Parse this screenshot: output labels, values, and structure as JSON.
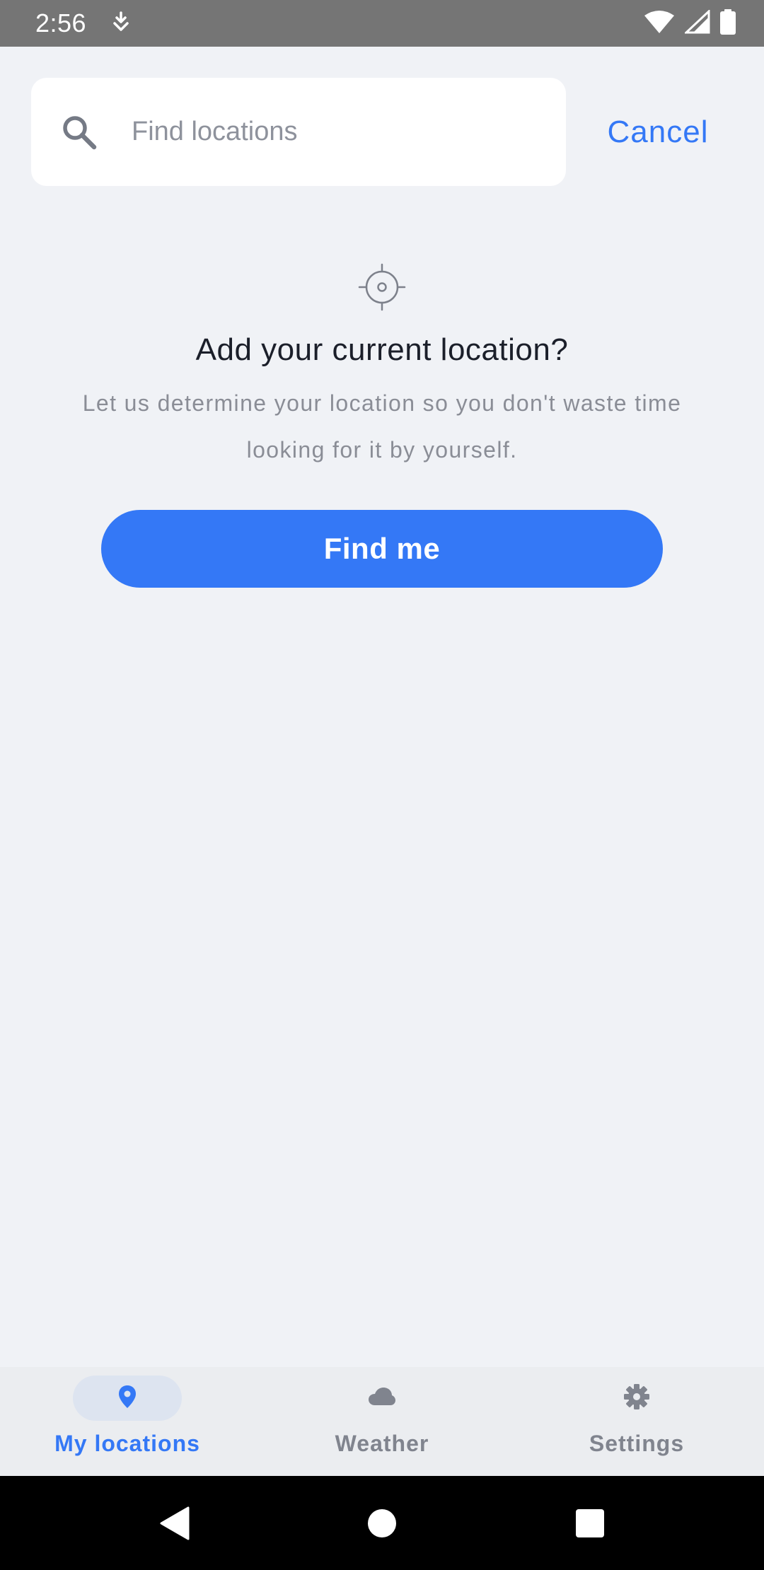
{
  "status_bar": {
    "time": "2:56",
    "icons": [
      "download-status-icon",
      "wifi-icon",
      "signal-icon",
      "battery-icon"
    ]
  },
  "search": {
    "placeholder": "Find locations",
    "value": "",
    "cancel_label": "Cancel"
  },
  "empty_state": {
    "icon": "crosshair-locate-icon",
    "title": "Add your current location?",
    "description": "Let us determine your location so you don't waste time looking for it by yourself.",
    "button_label": "Find me"
  },
  "bottom_nav": {
    "items": [
      {
        "label": "My locations",
        "icon": "map-pin-icon",
        "active": true
      },
      {
        "label": "Weather",
        "icon": "cloud-icon",
        "active": false
      },
      {
        "label": "Settings",
        "icon": "gear-icon",
        "active": false
      }
    ]
  },
  "system_nav": {
    "buttons": [
      "back-icon",
      "home-icon",
      "recents-icon"
    ]
  },
  "colors": {
    "accent": "#3478f6",
    "background": "#f0f2f6",
    "status_bar": "#757575"
  }
}
